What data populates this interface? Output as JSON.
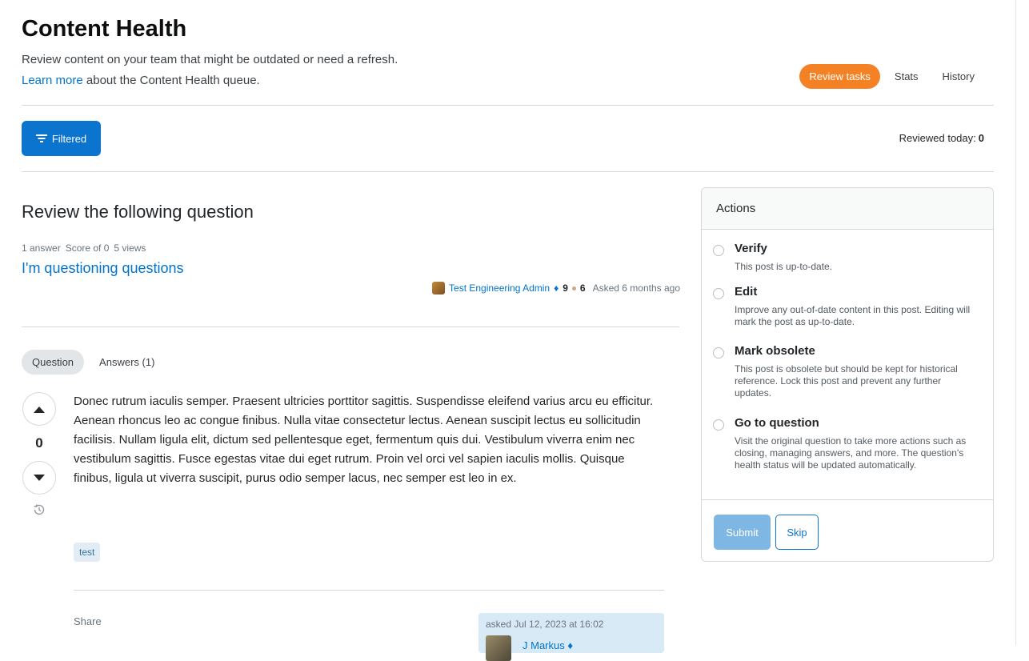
{
  "header": {
    "title": "Content Health",
    "subtitle": "Review content on your team that might be outdated or need a refresh.",
    "learn_more_link": "Learn more",
    "learn_more_rest": " about the Content Health queue."
  },
  "nav": {
    "tabs": [
      {
        "label": "Review tasks",
        "active": true
      },
      {
        "label": "Stats",
        "active": false
      },
      {
        "label": "History",
        "active": false
      }
    ]
  },
  "toolbar": {
    "filter_label": "Filtered",
    "reviewed_label": "Reviewed today:",
    "reviewed_count": "0"
  },
  "review": {
    "heading": "Review the following question",
    "stats": [
      "1 answer",
      "Score of 0",
      "5 views"
    ],
    "question_title": "I'm questioning questions",
    "author": {
      "name": "Test Engineering Admin",
      "reputation": "9",
      "bronze": "6",
      "asked": "Asked 6 months ago"
    }
  },
  "question_tabs": [
    {
      "label": "Question",
      "active": true
    },
    {
      "label": "Answers (1)",
      "active": false
    }
  ],
  "post": {
    "vote_count": "0",
    "body": "Donec rutrum iaculis semper. Praesent ultricies porttitor sagittis. Suspendisse eleifend varius arcu eu efficitur. Aenean rhoncus leo ac congue finibus. Nulla vitae consectetur lectus. Aenean suscipit lectus eu sollicitudin facilisis. Nullam ligula elit, dictum sed pellentesque eget, fermentum quis dui. Vestibulum viverra enim nec vestibulum sagittis. Fusce egestas vitae dui eget rutrum. Proin vel orci vel sapien iaculis mollis. Quisque finibus, ligula ut viverra suscipit, purus odio semper lacus, nec semper est leo in ex.",
    "tag": "test",
    "share_label": "Share",
    "asked_info": "asked Jul 12, 2023 at 16:02",
    "owner_name": "J Markus"
  },
  "actions": {
    "heading": "Actions",
    "options": [
      {
        "label": "Verify",
        "desc": "This post is up-to-date."
      },
      {
        "label": "Edit",
        "desc": "Improve any out-of-date content in this post. Editing will mark the post as up-to-date."
      },
      {
        "label": "Mark obsolete",
        "desc": "This post is obsolete but should be kept for historical reference. Lock this post and prevent any further updates."
      },
      {
        "label": "Go to question",
        "desc": "Visit the original question to take more actions such as closing, managing answers, and more. The question's health status will be updated automatically."
      }
    ],
    "submit_label": "Submit",
    "skip_label": "Skip"
  },
  "colors": {
    "accent_orange": "#f48225",
    "primary_blue": "#0a74cf",
    "link_blue": "#0074cc",
    "tag_bg": "#e1ecf4"
  },
  "icons": [
    "filter-icon",
    "upvote-icon",
    "downvote-icon",
    "history-icon",
    "moderator-diamond-icon",
    "bronze-badge-icon"
  ]
}
